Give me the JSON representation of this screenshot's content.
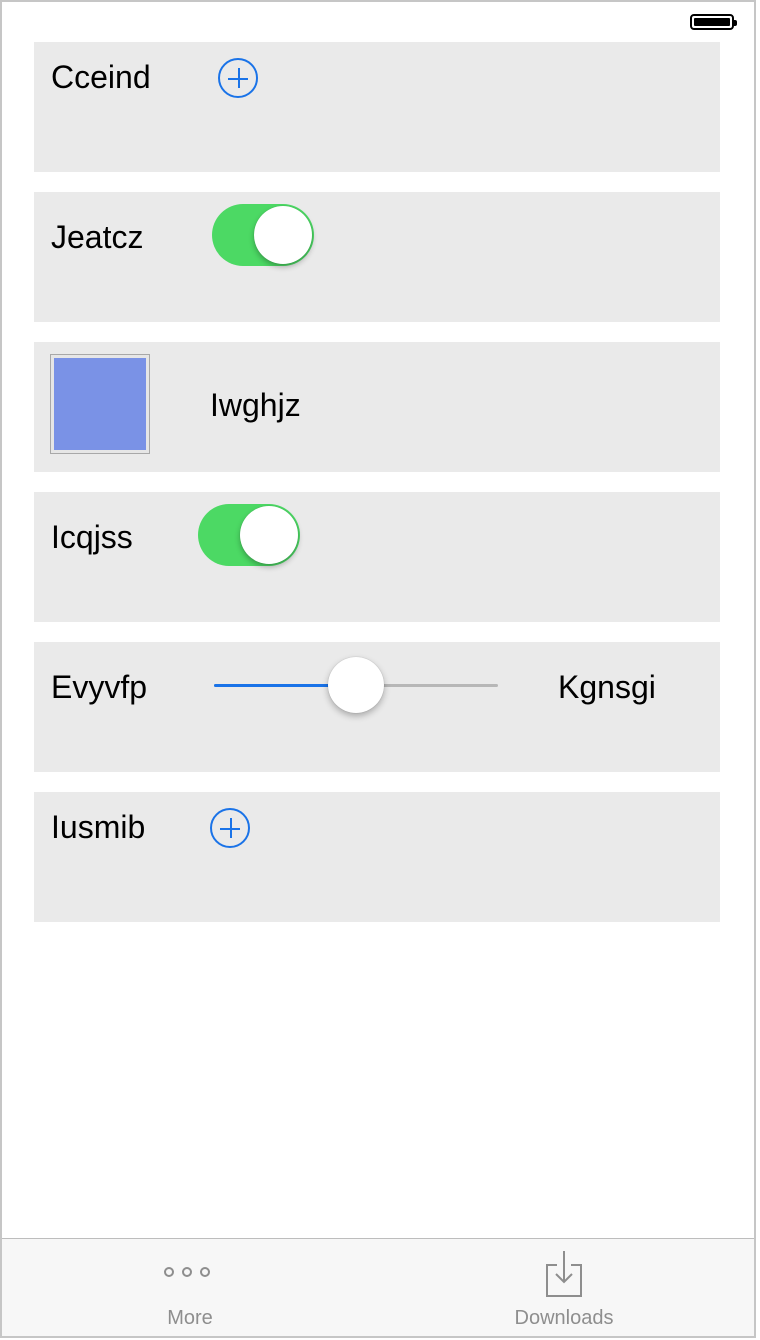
{
  "status_bar": {
    "battery_icon": "battery-full-icon"
  },
  "rows": [
    {
      "type": "label-add",
      "label": "Cceind",
      "icon": "plus-circle-icon"
    },
    {
      "type": "label-toggle",
      "label": "Jeatcz",
      "toggle_on": true
    },
    {
      "type": "swatch-label",
      "label": "Iwghjz",
      "swatch_color": "#7a92e6"
    },
    {
      "type": "label-toggle",
      "label": "Icqjss",
      "toggle_on": true
    },
    {
      "type": "label-slider",
      "label": "Evyvfp",
      "slider_value": 0.5,
      "end_label": "Kgnsgi"
    },
    {
      "type": "label-add",
      "label": "Iusmib",
      "icon": "plus-circle-icon"
    }
  ],
  "colors": {
    "accent": "#1a73e8",
    "toggle_on": "#4cd964",
    "row_background": "#eaeaea",
    "tab_label": "#8e8e8e"
  },
  "tab_bar": {
    "tabs": [
      {
        "label": "More",
        "icon": "more-dots-icon"
      },
      {
        "label": "Downloads",
        "icon": "download-icon"
      }
    ]
  }
}
